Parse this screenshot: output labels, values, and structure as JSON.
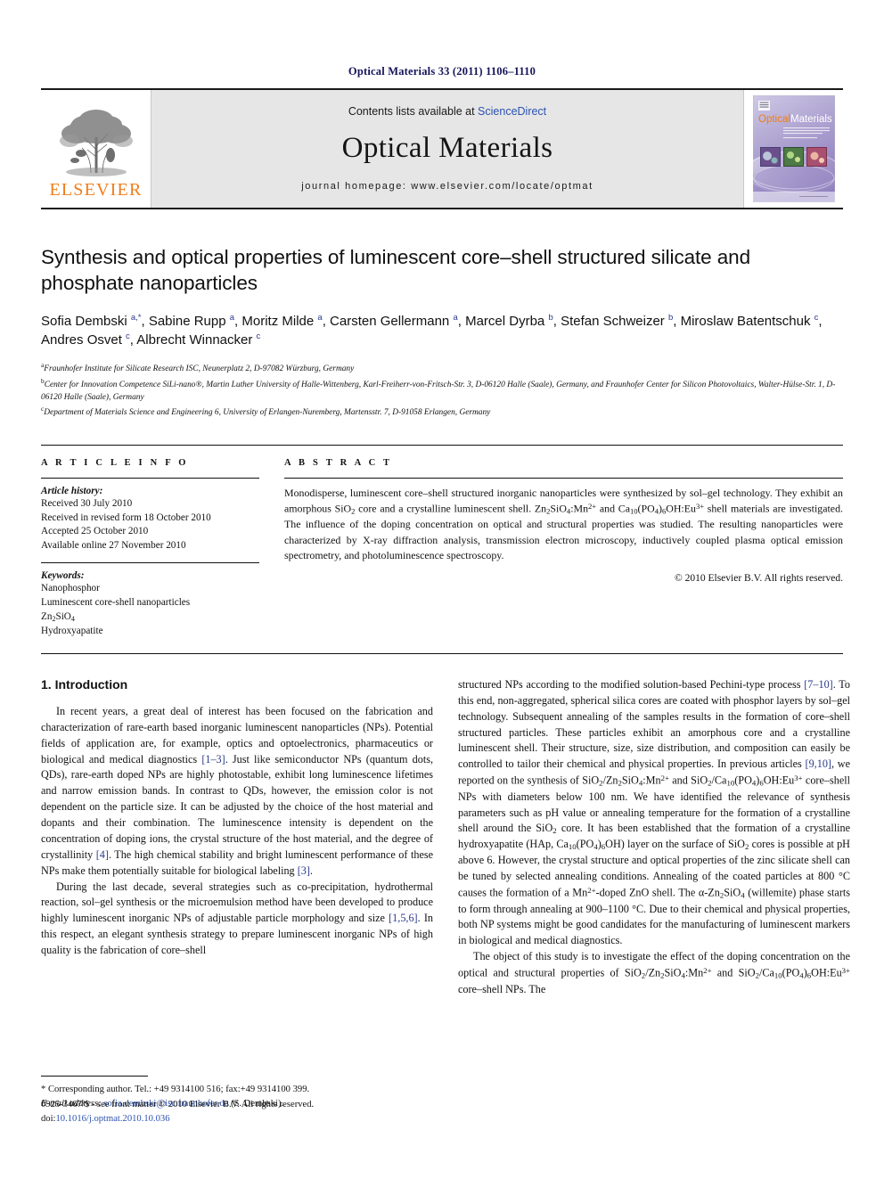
{
  "running_head": "Optical Materials 33 (2011) 1106–1110",
  "masthead": {
    "publisher_name": "ELSEVIER",
    "contents_prefix": "Contents lists available at ",
    "contents_link": "ScienceDirect",
    "journal_name": "Optical Materials",
    "homepage": "journal homepage: www.elsevier.com/locate/optmat",
    "cover": {
      "title_part1": "Optical",
      "title_part2": "Materials",
      "accent_color": "#ef7d1a",
      "background_color": "#b8b0d8"
    }
  },
  "article": {
    "title": "Synthesis and optical properties of luminescent core–shell structured silicate and phosphate nanoparticles",
    "authors_html": "Sofia Dembski <sup>a,*</sup>, Sabine Rupp <sup>a</sup>, Moritz Milde <sup>a</sup>, Carsten Gellermann <sup>a</sup>, Marcel Dyrba <sup>b</sup>, Stefan Schweizer <sup>b</sup>, Miroslaw Batentschuk <sup>c</sup>, Andres Osvet <sup>c</sup>, Albrecht Winnacker <sup>c</sup>",
    "affiliations": [
      "Fraunhofer Institute for Silicate Research ISC, Neunerplatz 2, D-97082 Würzburg, Germany",
      "Center for Innovation Competence SiLi-nano®, Martin Luther University of Halle-Wittenberg, Karl-Freiherr-von-Fritsch-Str. 3, D-06120 Halle (Saale), Germany, and Fraunhofer Center for Silicon Photovoltaics, Walter-Hülse-Str. 1, D-06120 Halle (Saale), Germany",
      "Department of Materials Science and Engineering 6, University of Erlangen-Nuremberg, Martensstr. 7, D-91058 Erlangen, Germany"
    ],
    "affiliation_marks": [
      "a",
      "b",
      "c"
    ]
  },
  "article_info": {
    "heading": "A R T I C L E   I N F O",
    "history_label": "Article history:",
    "history": [
      "Received 30 July 2010",
      "Received in revised form 18 October 2010",
      "Accepted 25 October 2010",
      "Available online 27 November 2010"
    ],
    "keywords_label": "Keywords:",
    "keywords_html": [
      "Nanophosphor",
      "Luminescent core-shell nanoparticles",
      "Zn<sub>2</sub>SiO<sub>4</sub>",
      "Hydroxyapatite"
    ]
  },
  "abstract": {
    "heading": "A B S T R A C T",
    "body_html": "Monodisperse, luminescent core–shell structured inorganic nanoparticles were synthesized by sol–gel technology. They exhibit an amorphous SiO<sub>2</sub> core and a crystalline luminescent shell. Zn<sub>2</sub>SiO<sub>4</sub>:Mn<sup class=\"chem\">2+</sup> and Ca<sub>10</sub>(PO<sub>4</sub>)<sub>6</sub>OH:Eu<sup class=\"chem\">3+</sup> shell materials are investigated. The influence of the doping concentration on optical and structural properties was studied. The resulting nanoparticles were characterized by X-ray diffraction analysis, transmission electron microscopy, inductively coupled plasma optical emission spectrometry, and photoluminescence spectroscopy.",
    "copyright": "© 2010 Elsevier B.V. All rights reserved."
  },
  "introduction": {
    "heading": "1. Introduction",
    "left_paragraphs_html": [
      "In recent years, a great deal of interest has been focused on the fabrication and characterization of rare-earth based inorganic luminescent nanoparticles (NPs). Potential fields of application are, for example, optics and optoelectronics, pharmaceutics or biological and medical diagnostics <span class=\"ref\">[1–3]</span>. Just like semiconductor NPs (quantum dots, QDs), rare-earth doped NPs are highly photostable, exhibit long luminescence lifetimes and narrow emission bands. In contrast to QDs, however, the emission color is not dependent on the particle size. It can be adjusted by the choice of the host material and dopants and their combination. The luminescence intensity is dependent on the concentration of doping ions, the crystal structure of the host material, and the degree of crystallinity <span class=\"ref\">[4]</span>. The high chemical stability and bright luminescent performance of these NPs make them potentially suitable for biological labeling <span class=\"ref\">[3]</span>.",
      "During the last decade, several strategies such as co-precipitation, hydrothermal reaction, sol–gel synthesis or the microemulsion method have been developed to produce highly luminescent inorganic NPs of adjustable particle morphology and size <span class=\"ref\">[1,5,6]</span>. In this respect, an elegant synthesis strategy to prepare luminescent inorganic NPs of high quality is the fabrication of core–shell"
    ],
    "right_paragraphs_html": [
      "structured NPs according to the modified solution-based Pechini-type process <span class=\"ref\">[7–10]</span>. To this end, non-aggregated, spherical silica cores are coated with phosphor layers by sol–gel technology. Subsequent annealing of the samples results in the formation of core–shell structured particles. These particles exhibit an amorphous core and a crystalline luminescent shell. Their structure, size, size distribution, and composition can easily be controlled to tailor their chemical and physical properties. In previous articles <span class=\"ref\">[9,10]</span>, we reported on the synthesis of SiO<sub>2</sub>/Zn<sub>2</sub>SiO<sub>4</sub>:Mn<sup class=\"chem\">2+</sup> and SiO<sub>2</sub>/Ca<sub>10</sub>(PO<sub>4</sub>)<sub>6</sub>OH:Eu<sup class=\"chem\">3+</sup> core–shell NPs with diameters below 100 nm. We have identified the relevance of synthesis parameters such as pH value or annealing temperature for the formation of a crystalline shell around the SiO<sub>2</sub> core. It has been established that the formation of a crystalline hydroxyapatite (HAp, Ca<sub>10</sub>(PO<sub>4</sub>)<sub>6</sub>OH) layer on the surface of SiO<sub>2</sub> cores is possible at pH above 6. However, the crystal structure and optical properties of the zinc silicate shell can be tuned by selected annealing conditions. Annealing of the coated particles at 800 °C causes the formation of a Mn<sup class=\"chem\">2+</sup>-doped ZnO shell. The α-Zn<sub>2</sub>SiO<sub>4</sub> (willemite) phase starts to form through annealing at 900–1100 °C. Due to their chemical and physical properties, both NP systems might be good candidates for the manufacturing of luminescent markers in biological and medical diagnostics.",
      "The object of this study is to investigate the effect of the doping concentration on the optical and structural properties of SiO<sub>2</sub>/Zn<sub>2</sub>SiO<sub>4</sub>:Mn<sup class=\"chem\">2+</sup> and SiO<sub>2</sub>/Ca<sub>10</sub>(PO<sub>4</sub>)<sub>6</sub>OH:Eu<sup class=\"chem\">3+</sup> core–shell NPs. The"
    ]
  },
  "footnote": {
    "corresponding_html": "* Corresponding author. Tel.: +49 9314100 516; fax:+49 9314100 399.",
    "email_label": "E-mail address:",
    "email": "sofia.dembski@isc.fraunhofer.de",
    "email_suffix": "(S. Dembski)."
  },
  "page_footer": {
    "issn_line": "0925-3467/$ - see front matter © 2010 Elsevier B.V. All rights reserved.",
    "doi_label": "doi:",
    "doi_value": "10.1016/j.optmat.2010.10.036"
  }
}
